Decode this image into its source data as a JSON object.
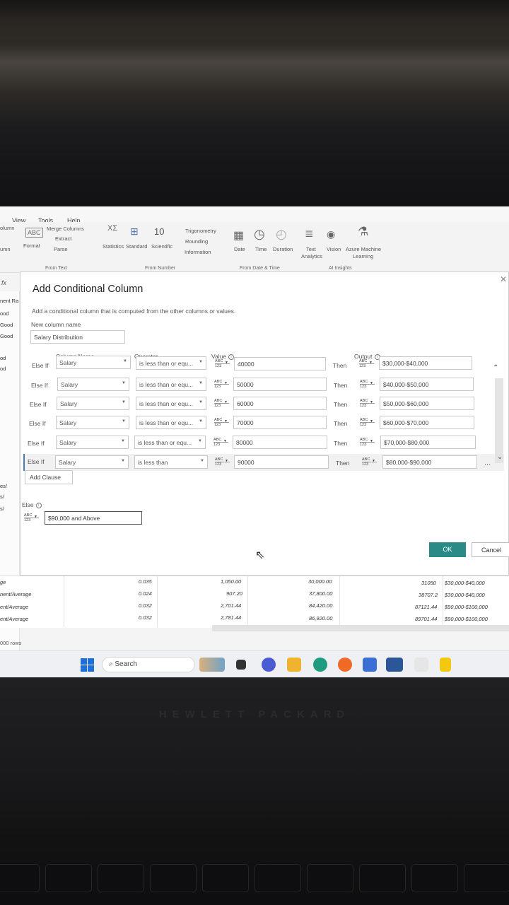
{
  "menu": {
    "view": "View",
    "tools": "Tools",
    "help": "Help"
  },
  "ribbon": {
    "column_frag": "olumn",
    "umn_frag": "umn",
    "format": "Format",
    "merge_columns": "Merge Columns",
    "extract": "Extract",
    "parse": "Parse",
    "statistics": "Statistics",
    "standard": "Standard",
    "scientific": "Scientific",
    "ten_power": "10",
    "trigonometry": "Trigonometry",
    "rounding": "Rounding",
    "information": "Information",
    "date": "Date",
    "time": "Time",
    "duration": "Duration",
    "text_analytics_1": "Text",
    "text_analytics_2": "Analytics",
    "vision": "Vision",
    "azure_ml_1": "Azure Machine",
    "azure_ml_2": "Learning",
    "group_from_text": "From Text",
    "group_from_number": "From Number",
    "group_from_date_time": "From Date & Time",
    "group_ai_insights": "AI Insights"
  },
  "left_fragments": [
    "nent Ra",
    "ood",
    "Good",
    "Good",
    "od",
    "od",
    "es/",
    "s/",
    "s/",
    "ge",
    "nent/Average",
    "ent/Average",
    "ent/Average"
  ],
  "dialog": {
    "title": "Add Conditional Column",
    "description": "Add a conditional column that is computed from the other columns or values.",
    "new_column_label": "New column name",
    "new_column_value": "Salary Distribution",
    "headers": {
      "column_name": "Column Name",
      "operator": "Operator",
      "value": "Value",
      "output": "Output"
    },
    "clauses": [
      {
        "keyword": "Else If",
        "column": "Salary",
        "operator": "is less than or equ...",
        "value": "40000",
        "then": "Then",
        "output": "$30,000-$40,000"
      },
      {
        "keyword": "Else If",
        "column": "Salary",
        "operator": "is less than or equ...",
        "value": "50000",
        "then": "Then",
        "output": "$40,000-$50,000"
      },
      {
        "keyword": "Else If",
        "column": "Salary",
        "operator": "is less than or equ...",
        "value": "60000",
        "then": "Then",
        "output": "$50,000-$60,000"
      },
      {
        "keyword": "Else If",
        "column": "Salary",
        "operator": "is less than or equ...",
        "value": "70000",
        "then": "Then",
        "output": "$60,000-$70,000"
      },
      {
        "keyword": "Else If",
        "column": "Salary",
        "operator": "is less than or equ...",
        "value": "80000",
        "then": "Then",
        "output": "$70,000-$80,000"
      },
      {
        "keyword": "Else If",
        "column": "Salary",
        "operator": "is less than",
        "value": "90000",
        "then": "Then",
        "output": "$80,000-$90,000"
      }
    ],
    "type_abc": "ABC",
    "type_num": "123",
    "add_clause": "Add Clause",
    "else_label": "Else",
    "else_value": "$90,000 and Above",
    "ok": "OK",
    "cancel": "Cancel",
    "more": "..."
  },
  "grid_rows": [
    {
      "label": "ge",
      "rate": "0.035",
      "amount": "1,050.00",
      "salary": "30,000.00",
      "value": "31050",
      "band": "$30,000-$40,000"
    },
    {
      "label": "nent/Average",
      "rate": "0.024",
      "amount": "907.20",
      "salary": "37,800.00",
      "value": "38707.2",
      "band": "$30,000-$40,000"
    },
    {
      "label": "ent/Average",
      "rate": "0.032",
      "amount": "2,701.44",
      "salary": "84,420.00",
      "value": "87121.44",
      "band": "$90,000-$100,000"
    },
    {
      "label": "ent/Average",
      "rate": "0.032",
      "amount": "2,781.44",
      "salary": "86,920.00",
      "value": "89701.44",
      "band": "$90,000-$100,000"
    }
  ],
  "rows_label": "000 rows",
  "taskbar": {
    "search": "Search"
  },
  "brand": "HEWLETT PACKARD"
}
